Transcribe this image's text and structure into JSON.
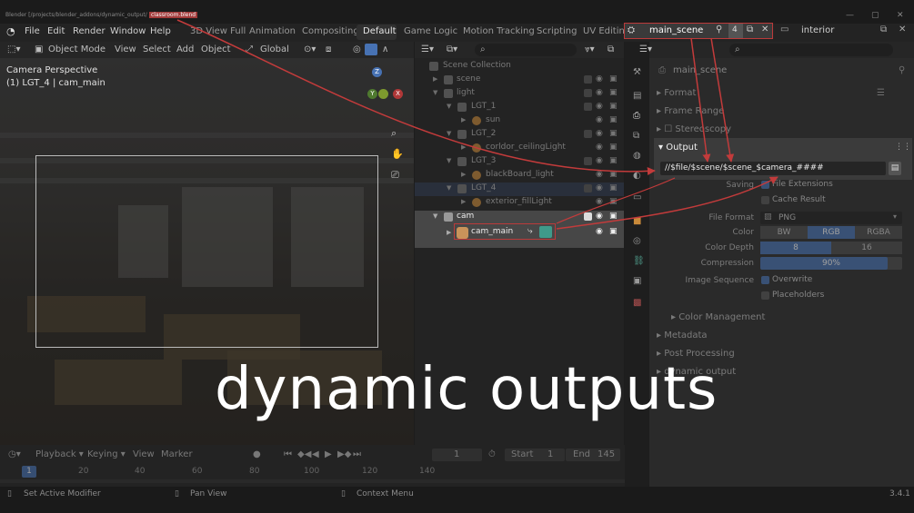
{
  "titlebar": {
    "title": "Blender [/projects/blender_addons/dynamic_output/",
    "file": "classroom.blend"
  },
  "menu": [
    "File",
    "Edit",
    "Render",
    "Window",
    "Help"
  ],
  "workspaces": [
    "3D View Full",
    "Animation",
    "Compositing",
    "Default",
    "Game Logic",
    "Motion Tracking",
    "Scripting",
    "UV Editin"
  ],
  "active_workspace": "Default",
  "scene_selector": {
    "name": "main_scene",
    "count": "4"
  },
  "view_layer": "interior",
  "viewport": {
    "mode": "Object Mode",
    "menus": [
      "View",
      "Select",
      "Add",
      "Object"
    ],
    "transform": "Global",
    "label_line1": "Camera Perspective",
    "label_line2": "(1) LGT_4 | cam_main"
  },
  "outliner": {
    "rows": [
      {
        "label": "Scene Collection",
        "indent": 0,
        "icon": "collection"
      },
      {
        "label": "scene",
        "indent": 1,
        "icon": "collection"
      },
      {
        "label": "light",
        "indent": 1,
        "icon": "collection"
      },
      {
        "label": "LGT_1",
        "indent": 2,
        "icon": "collection"
      },
      {
        "label": "sun",
        "indent": 3,
        "icon": "light"
      },
      {
        "label": "LGT_2",
        "indent": 2,
        "icon": "collection"
      },
      {
        "label": "corldor_ceilingLight",
        "indent": 3,
        "icon": "light"
      },
      {
        "label": "LGT_3",
        "indent": 2,
        "icon": "collection"
      },
      {
        "label": "blackBoard_light",
        "indent": 3,
        "icon": "light"
      },
      {
        "label": "LGT_4",
        "indent": 2,
        "icon": "collection"
      },
      {
        "label": "exterior_fillLight",
        "indent": 3,
        "icon": "light"
      },
      {
        "label": "cam",
        "indent": 1,
        "icon": "collection"
      },
      {
        "label": "cam_main",
        "indent": 2,
        "icon": "camera"
      }
    ]
  },
  "properties": {
    "scene_label": "main_scene",
    "panels_top": [
      "Format",
      "Frame Range",
      "Stereoscopy"
    ],
    "output_title": "Output",
    "output_path": "//$file/$scene/$scene_$camera_####",
    "saving_label": "Saving",
    "file_extensions": "File Extensions",
    "cache_result": "Cache Result",
    "file_format_label": "File Format",
    "file_format": "PNG",
    "color_label": "Color",
    "color_opts": [
      "BW",
      "RGB",
      "RGBA"
    ],
    "color_depth_label": "Color Depth",
    "color_depth_opts": [
      "8",
      "16"
    ],
    "compression_label": "Compression",
    "compression": "90%",
    "compression_value": 0.9,
    "image_sequence_label": "Image Sequence",
    "overwrite": "Overwrite",
    "placeholders": "Placeholders",
    "color_management": "Color Management",
    "panels_bottom": [
      "Metadata",
      "Post Processing",
      "dynamic output"
    ]
  },
  "timeline": {
    "menus": [
      "Playback",
      "Keying",
      "View",
      "Marker"
    ],
    "current_frame": "1",
    "start_label": "Start",
    "start": "1",
    "end_label": "End",
    "end": "145",
    "ticks": [
      "20",
      "40",
      "60",
      "80",
      "100",
      "120",
      "140"
    ],
    "frame_badge": "1"
  },
  "statusbar": {
    "items": [
      "Set Active Modifier",
      "Pan View",
      "Context Menu"
    ],
    "version": "3.4.1"
  },
  "overlay_text": "dynamic outputs",
  "colors": {
    "accent": "#4772b3",
    "highlight_red": "#bb3a3a"
  }
}
